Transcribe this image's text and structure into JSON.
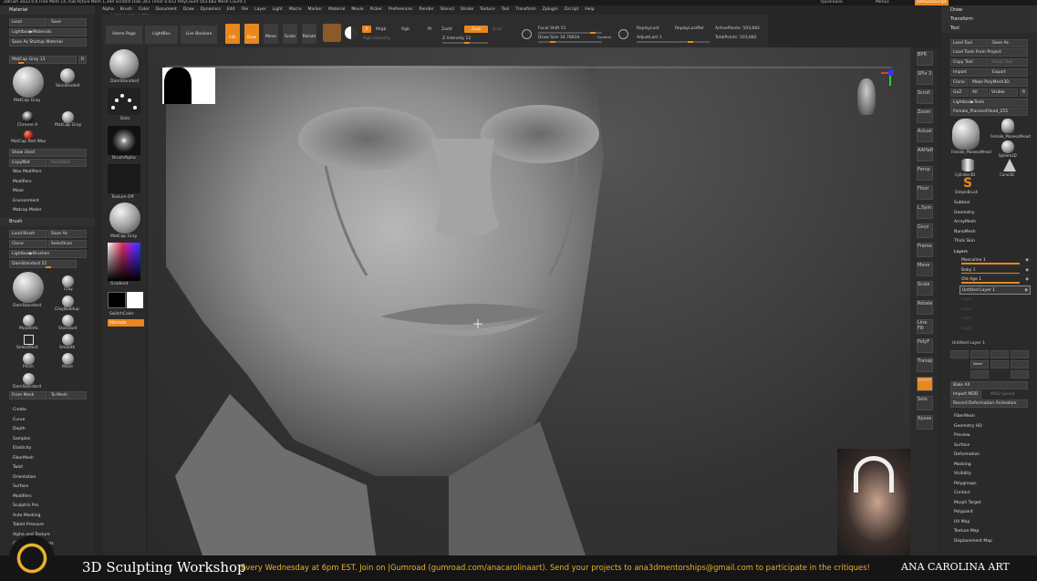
{
  "topbar": {
    "text": "ZBrush 2022.0.6   Free Mem 14.7GB  Active Mem 1,394  Scratch Disk 343  Timer 0.012  PolyCount 503,682  Mesh Count 1",
    "quicksave": "QuickSave",
    "menus_label": "Menus",
    "default_script": "DefaultZScript"
  },
  "menu": [
    "Alpha",
    "Brush",
    "Color",
    "Document",
    "Draw",
    "Dynamics",
    "Edit",
    "File",
    "Layer",
    "Light",
    "Macro",
    "Marker",
    "Material",
    "Movie",
    "Picker",
    "Preferences",
    "Render",
    "Stencil",
    "Stroke",
    "Texture",
    "Tool",
    "Transform",
    "Zplugin",
    "Zscript",
    "Help"
  ],
  "coords": "-0.156,0.048,-0.779",
  "toolbar": {
    "home": "Home Page",
    "lightbox": "LightBox",
    "live_boolean": "Live Boolean",
    "edit": "Edit",
    "draw": "Draw",
    "move": "Move",
    "scale": "Scale",
    "rotate": "Rotate",
    "a": "A",
    "mrgb": "Mrgb",
    "rgb": "Rgb",
    "m": "M",
    "zadd": "Zadd",
    "zsub": "Zsub",
    "zcut": "Zcut",
    "rgb_intensity": "Rgb Intensity",
    "z_intensity": "Z Intensity 12",
    "focal_shift": "Focal Shift 51",
    "draw_size": "Draw Size 34.78834",
    "dynamic": "Dynamic",
    "replay_last": "ReplayLast",
    "replay_last_rel": "ReplayLastRel",
    "adjust_last": "AdjustLast 1",
    "active_points": "ActivePoints: 503,682",
    "total_points": "TotalPoints: 503,682"
  },
  "left": {
    "material_title": "Material",
    "load": "Load",
    "save": "Save",
    "lightbox_materials": "Lightbox▶Materials",
    "save_startup": "Save As Startup Material",
    "matcap_gray_slider": "MatCap Gray 13",
    "r": "R",
    "materials": [
      "MatCap Gray",
      "SkinShade4",
      "Chrome A",
      "MatCap Gray",
      "MatCap Red Wax"
    ],
    "show_used": "Show Used",
    "copy_mat": "CopyMat",
    "paste_mat": "PasteMat",
    "sub_items": [
      "Wax Modifiers",
      "Modifiers",
      "Mixer",
      "Environment",
      "Matcap Maker"
    ],
    "brush_title": "Brush",
    "load_brush": "Load Brush",
    "save_as": "Save As",
    "clone": "Clone",
    "select_icon": "SelectIcon",
    "lightbox_brushes": "Lightbox▶Brushes",
    "dam_slider": "DamStandard 52",
    "brushes": [
      "DamStandard",
      "Clay",
      "ClayBuildup",
      "MoveInfo",
      "Standard",
      "SelectRect",
      "Smooth",
      "Pinch",
      "Move",
      "DamStandard"
    ],
    "from_mesh": "From Mesh",
    "to_mesh": "To Mesh",
    "brush_subs": [
      "Create",
      "Curve",
      "Depth",
      "Samples",
      "Elasticity",
      "FiberMesh",
      "Twist",
      "Orientation",
      "Surface",
      "Modifiers",
      "Sculptris Pro",
      "Auto Masking",
      "Tablet Pressure",
      "Alpha and Texture",
      "Clip Brush Modifiers"
    ]
  },
  "shelf": {
    "brush": "DamStandard",
    "dots": "Dots",
    "alpha": "BrushAlpha",
    "texture": "Texture Off",
    "mat": "MatCap Gray",
    "gradient": "Gradient",
    "switch_color": "SwitchColor",
    "alternate": "Alternate"
  },
  "rshelf": [
    "BPR",
    "SPix 3",
    "Scroll",
    "Zoom",
    "Actual",
    "AAHalf",
    "Persp",
    "Floor",
    "L.Sym",
    "Gxyz",
    "Frame",
    "Move",
    "Scale",
    "Rotate",
    "Line Fill",
    "PolyF",
    "Transp",
    "Ghost",
    "Solo",
    "Xpose"
  ],
  "right": {
    "draw": "Draw",
    "transform": "Transform",
    "tool": "Tool",
    "load_tool": "Load Tool",
    "save_as": "Save As",
    "load_tools_project": "Load Tools From Project",
    "copy_tool": "Copy Tool",
    "paste_tool": "Paste Tool",
    "import": "Import",
    "export": "Export",
    "clone": "Clone",
    "make_polymesh": "Make PolyMesh3D",
    "goz": "GoZ",
    "all": "All",
    "visible": "Visible",
    "r": "R",
    "lightbox_tools": "Lightbox▶Tools",
    "tool_slider": "Female_PlanesofHead_255",
    "tools": [
      "Female_PlanesofHead",
      "Female_PlanesofHead",
      "Sphere3D",
      "Cylinder3D",
      "PolyMesh3D",
      "Cone3D",
      "SimpleBrush"
    ],
    "tool_subs": [
      "Subtool",
      "Geometry",
      "ArrayMesh",
      "NanoMesh",
      "Thick Skin"
    ],
    "layers": "Layers",
    "layer_items": [
      "Masculine 1",
      "Baby 1",
      "Old Age 1",
      "Untitled Layer 1"
    ],
    "empty_layers": [
      "Layer",
      "Layer",
      "Layer",
      "Layer"
    ],
    "current_layer": "Untitled Layer 1",
    "name_btn": "Name",
    "bake_all": "Bake All",
    "import_mdd": "Import MDD",
    "mdd_speed": "MDD Speed",
    "record_deformation": "Record Deformation Animation",
    "more_subs": [
      "FiberMesh",
      "Geometry HD",
      "Preview",
      "Surface",
      "Deformation",
      "Masking",
      "Visibility",
      "Polygroups",
      "Contact",
      "Morph Target",
      "Polypaint",
      "UV Map",
      "Texture Map",
      "Displacement Map"
    ]
  },
  "banner": {
    "title": "3D Sculpting Workshop",
    "message": "Every Wednesday at 6pm EST. Join on |Gumroad (gumroad.com/anacarolinaart). Send your projects to ana3dmentorships@gmail.com to participate in the critiques!",
    "brand": "ANA CAROLINA ART"
  },
  "colors": {
    "accent": "#e8871e",
    "banner_text": "#e8b22a"
  }
}
